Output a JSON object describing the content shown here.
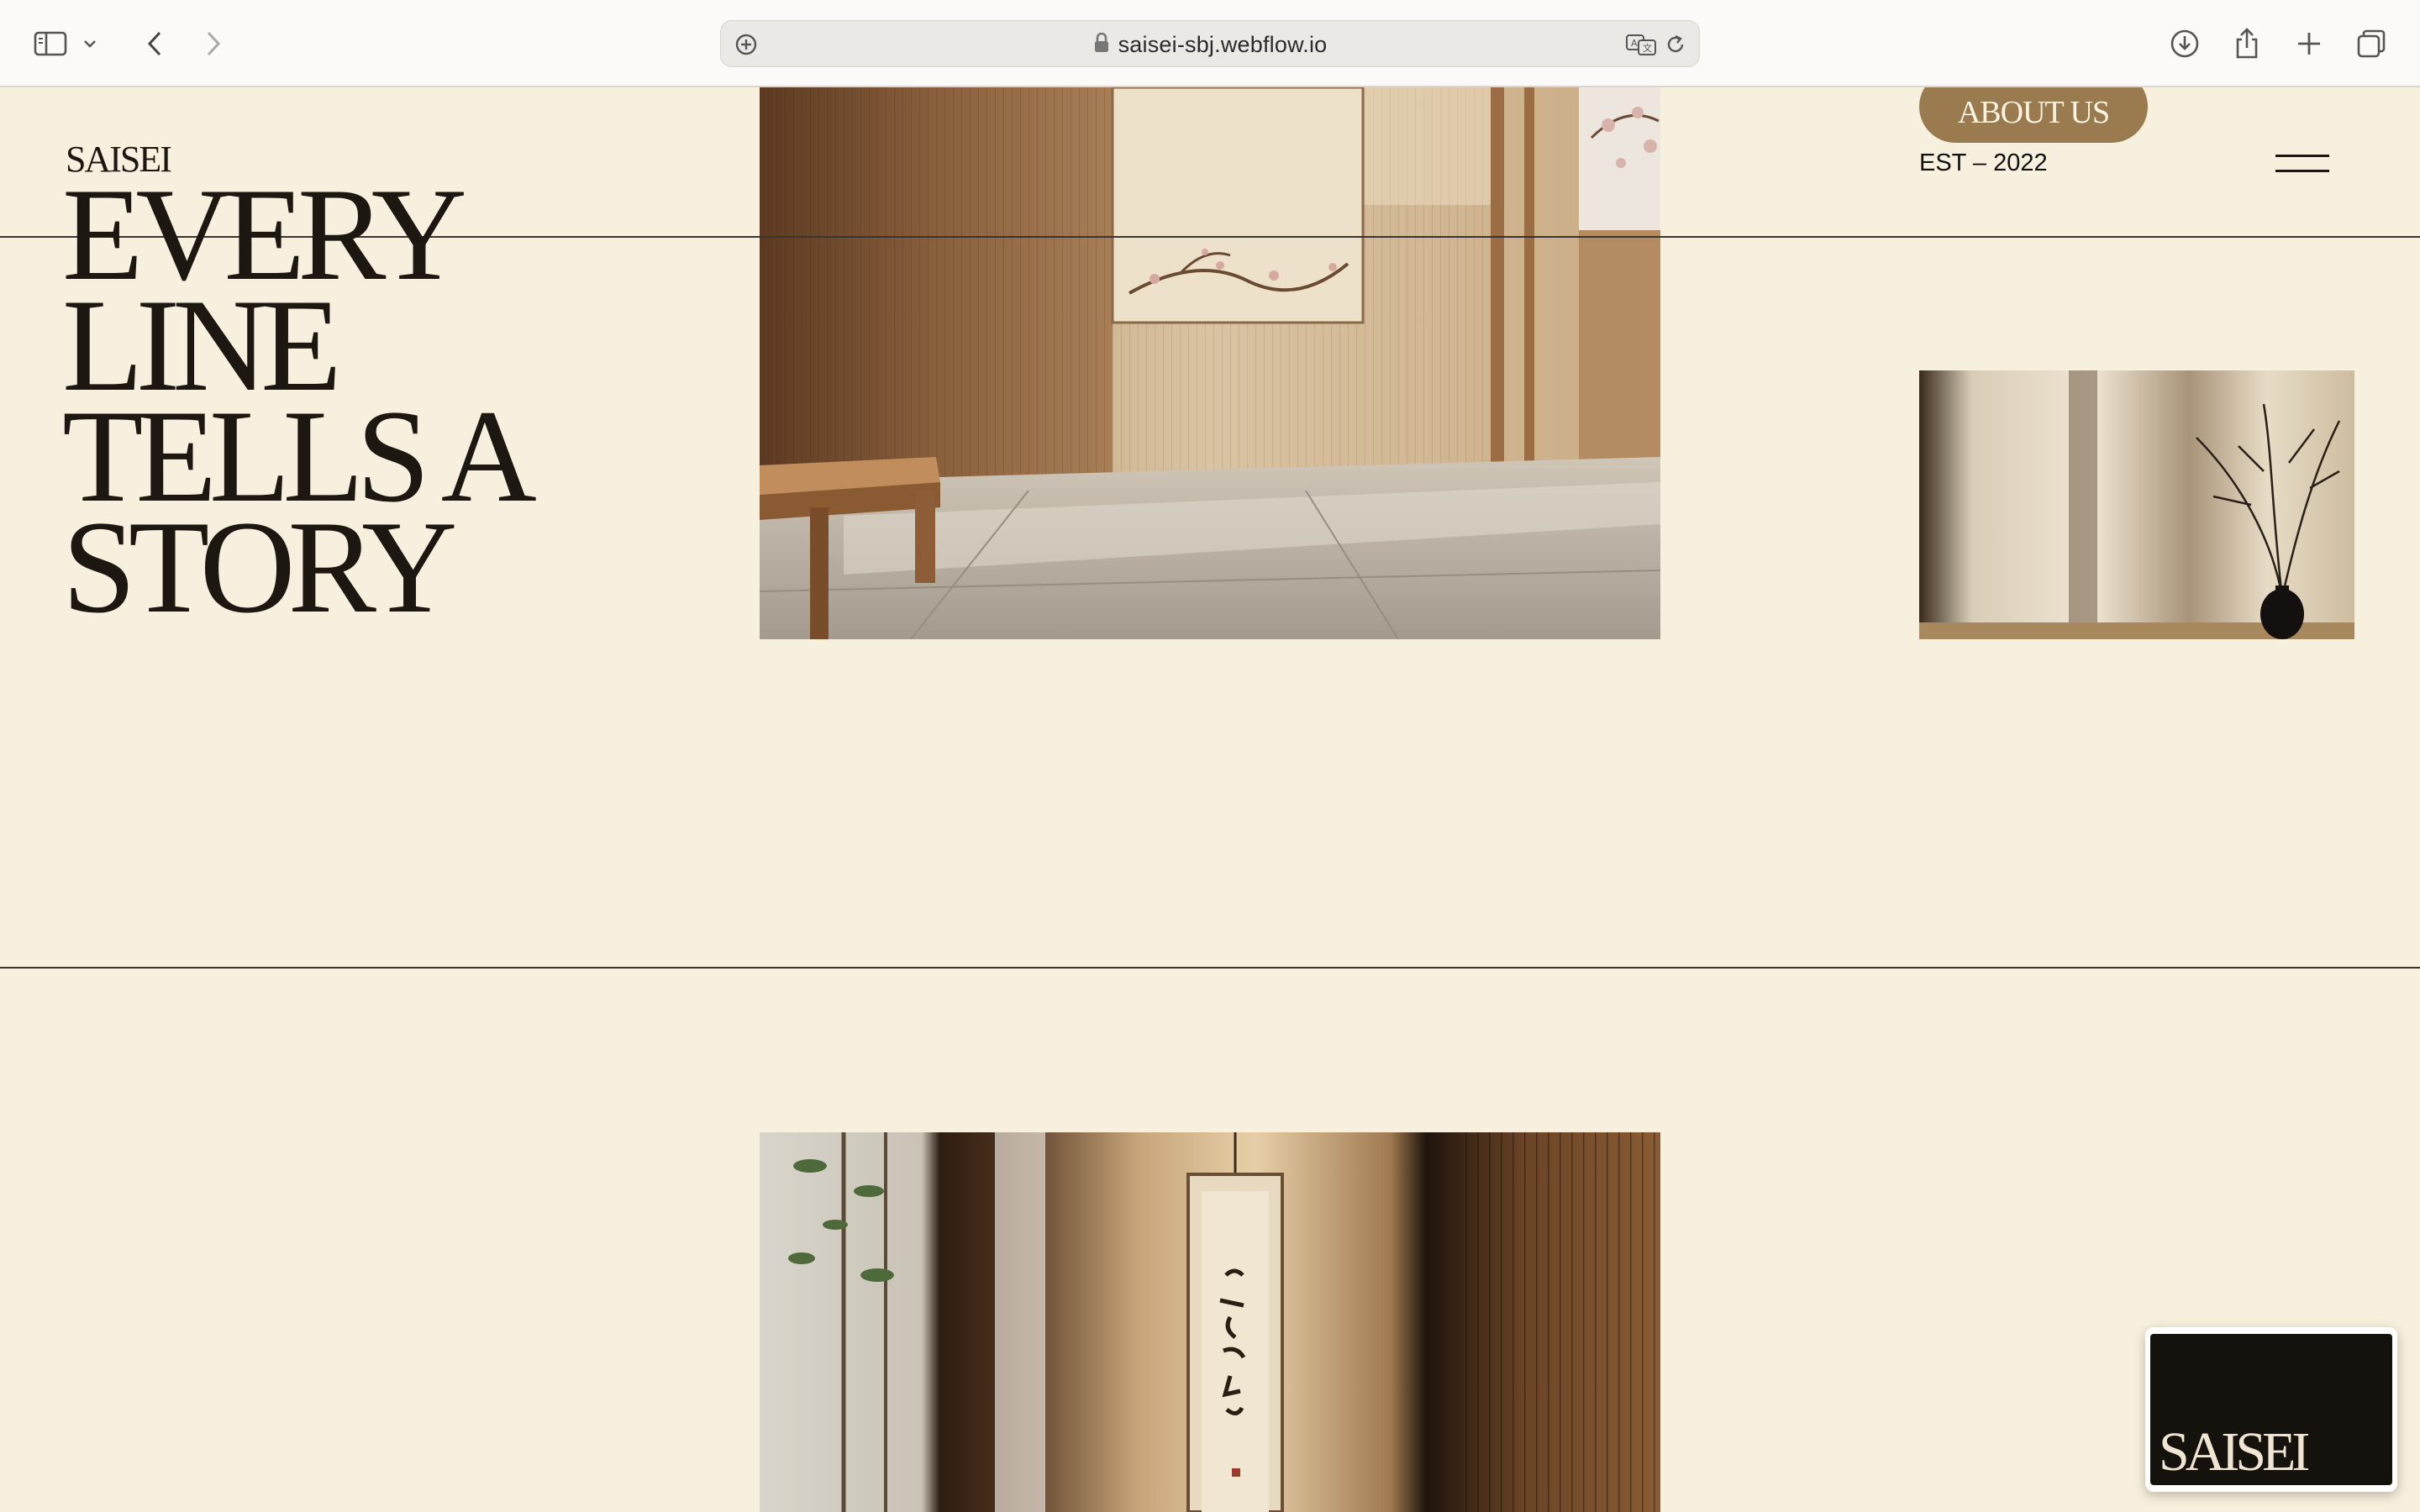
{
  "browser": {
    "url": "saisei-sbj.webflow.io",
    "icons": [
      "sidebar-icon",
      "chevron-down-icon",
      "back-icon",
      "forward-icon",
      "page-settings-icon",
      "lock-icon",
      "translate-icon",
      "reload-icon",
      "download-icon",
      "share-icon",
      "new-tab-icon",
      "tab-overview-icon"
    ]
  },
  "site": {
    "logo": "SAISEI",
    "headline": [
      "EVERY",
      "LINE",
      "TELLS A",
      "STORY"
    ],
    "about_button": "ABOUT US",
    "established": "EST – 2022",
    "menu_icon": "hamburger-icon"
  },
  "pip": {
    "logo": "SAISEI"
  },
  "colors": {
    "background": "#f8f0de",
    "text": "#1d1712",
    "accent": "#9a7b4f"
  }
}
